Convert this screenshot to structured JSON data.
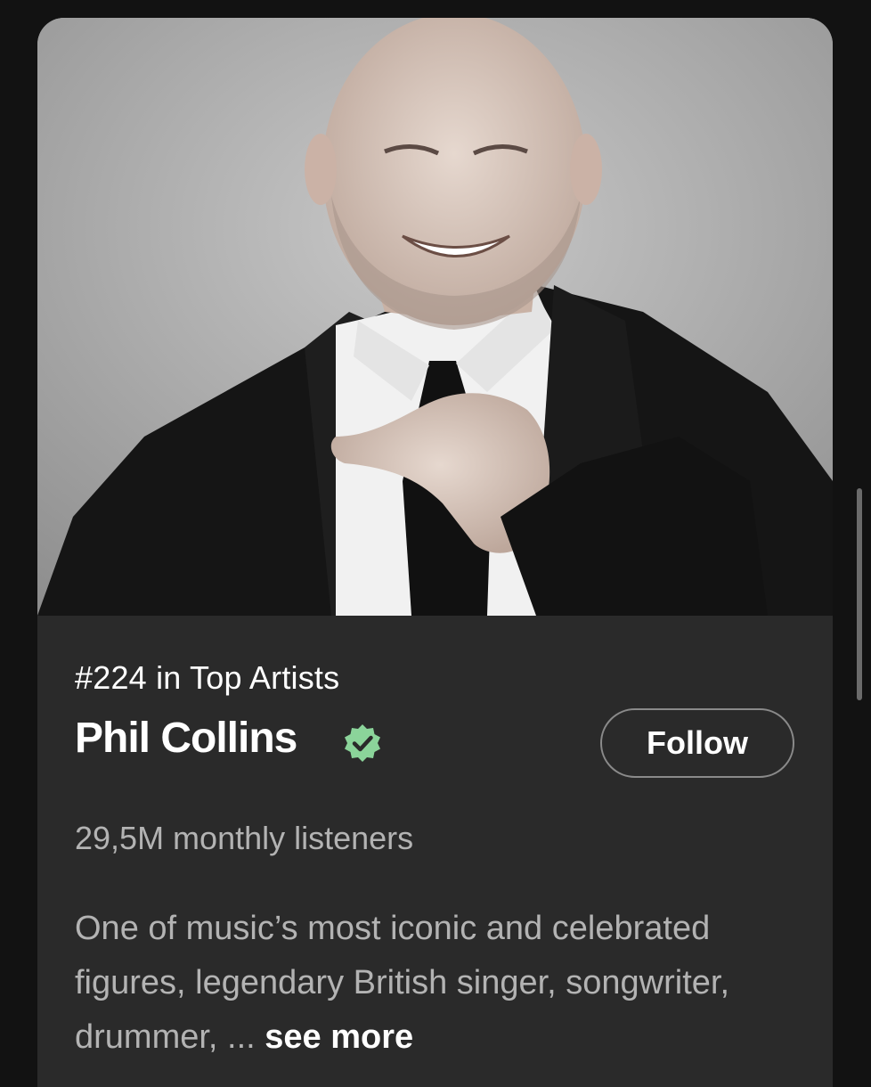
{
  "artist": {
    "rank_label": "#224 in Top Artists",
    "name": "Phil Collins",
    "verified_icon": "verified-badge-icon",
    "follow_label": "Follow",
    "monthly_listeners": "29,5M monthly listeners",
    "bio_text": "One of music’s most iconic and celebrated figures, legendary British singer, songwriter, drummer, ... ",
    "see_more_label": "see more"
  },
  "colors": {
    "background": "#121212",
    "card": "#2a2a2a",
    "verified": "#8bd49a",
    "text_primary": "#ffffff",
    "text_secondary": "#b3b3b3"
  }
}
